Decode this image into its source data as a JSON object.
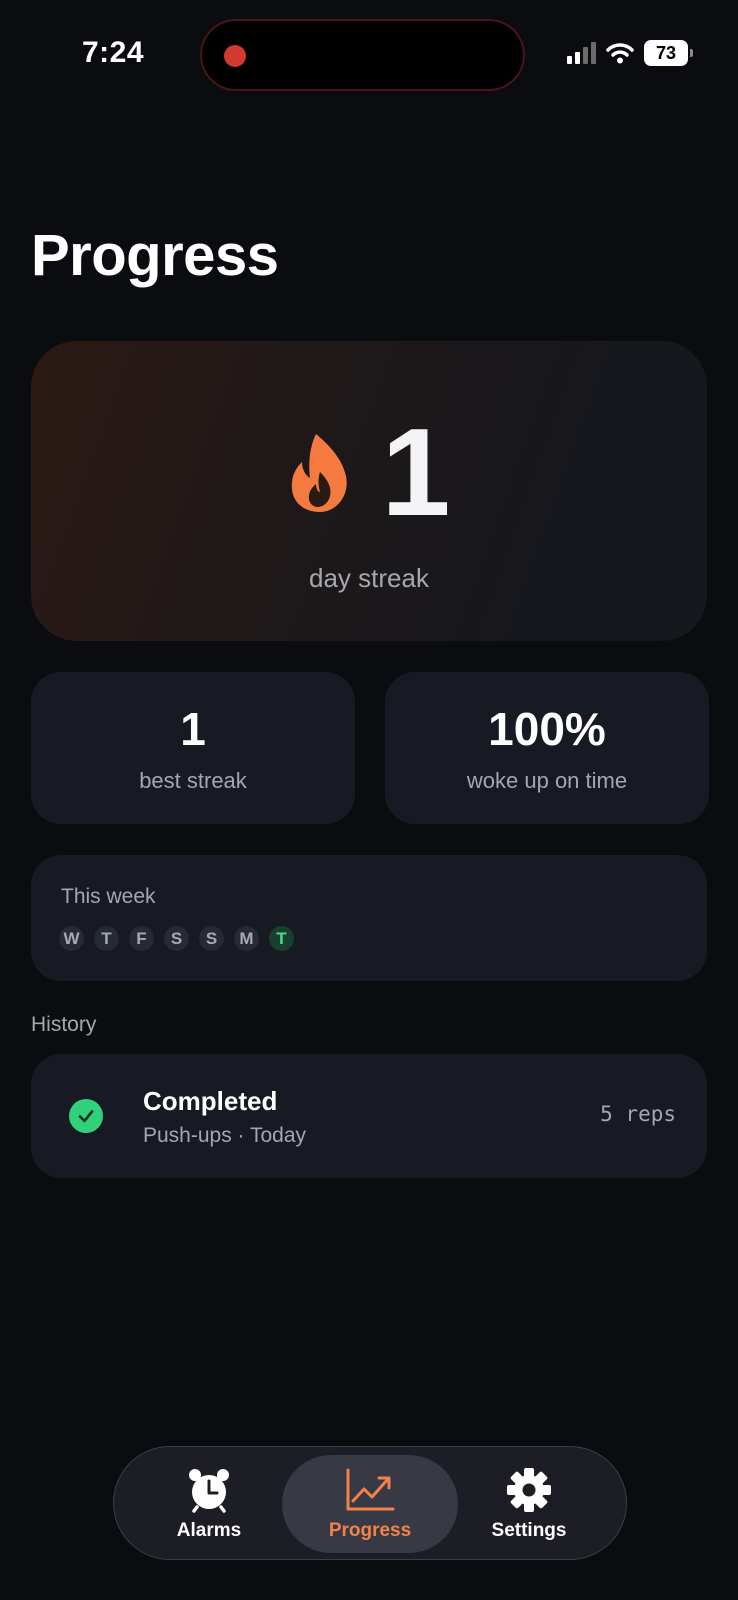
{
  "status_bar": {
    "time": "7:24",
    "battery": "73"
  },
  "page": {
    "title": "Progress"
  },
  "streak": {
    "value": "1",
    "label": "day streak",
    "icon": "flame-icon"
  },
  "stats": {
    "best_streak": {
      "value": "1",
      "label": "best streak"
    },
    "on_time": {
      "value": "100%",
      "label": "woke up on time"
    }
  },
  "week": {
    "title": "This week",
    "days": [
      "W",
      "T",
      "F",
      "S",
      "S",
      "M",
      "T"
    ],
    "active_index": 6
  },
  "history": {
    "heading": "History",
    "items": [
      {
        "status": "Completed",
        "detail": "Push-ups · Today",
        "reps": "5 reps",
        "icon": "check-circle-icon"
      }
    ]
  },
  "tab_bar": {
    "tabs": [
      {
        "label": "Alarms",
        "icon": "alarm-clock-icon"
      },
      {
        "label": "Progress",
        "icon": "chart-trend-icon",
        "active": true
      },
      {
        "label": "Settings",
        "icon": "gear-icon"
      }
    ]
  },
  "colors": {
    "background": "#0b0c10",
    "card": "#171a22",
    "accent": "#f2824a",
    "success": "#2fd27a",
    "muted_text": "#a5a7b0"
  }
}
